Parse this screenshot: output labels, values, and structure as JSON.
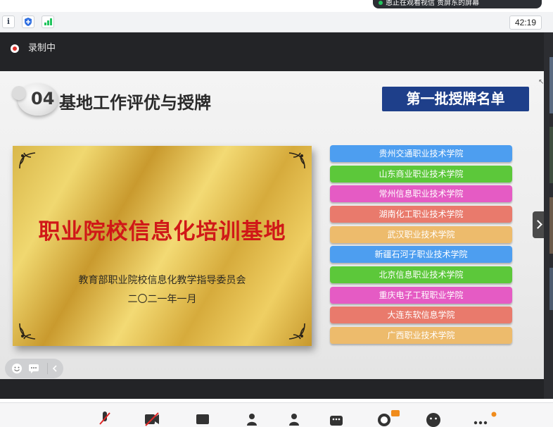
{
  "notification": {
    "text": "恩正在观看视信 贵屏东的屏幕",
    "icon": "green-dot"
  },
  "status_bar": {
    "timer": "42:19",
    "icons": [
      "info-icon",
      "shield-icon",
      "signal-icon"
    ]
  },
  "recording": {
    "label": "录制中",
    "icon": "record-dot"
  },
  "slide": {
    "section_number": "04",
    "section_title": "基地工作评优与授牌",
    "list_title": "第一批授牌名单",
    "plaque": {
      "title": "职业院校信息化培训基地",
      "issuer": "教育部职业院校信息化教学指导委员会",
      "date": "二〇二一年一月"
    },
    "schools": [
      {
        "name": "贵州交通职业技术学院",
        "color": "#4d9ef0"
      },
      {
        "name": "山东商业职业技术学院",
        "color": "#5cc83a"
      },
      {
        "name": "常州信息职业技术学院",
        "color": "#e55bc4"
      },
      {
        "name": "湖南化工职业技术学院",
        "color": "#e97a6c"
      },
      {
        "name": "武汉职业技术学院",
        "color": "#edbb6c"
      },
      {
        "name": "新疆石河子职业技术学院",
        "color": "#4d9ef0"
      },
      {
        "name": "北京信息职业技术学院",
        "color": "#5cc83a"
      },
      {
        "name": "重庆电子工程职业学院",
        "color": "#e55bc4"
      },
      {
        "name": "大连东软信息学院",
        "color": "#e97a6c"
      },
      {
        "name": "广西职业技术学院",
        "color": "#edbb6c"
      }
    ]
  },
  "float_toolbar": {
    "buttons": [
      "emoji-icon",
      "chat-icon",
      "collapse-icon"
    ]
  },
  "bottom_toolbar": {
    "icons": [
      "mic-muted-icon",
      "camera-off-icon",
      "share-icon",
      "participants-icon",
      "invite-icon",
      "apps-icon",
      "record-icon",
      "emoji-reaction-icon",
      "more-icon"
    ]
  },
  "colors": {
    "rec_bar": "#232427",
    "list_title_bg": "#1e3f8a",
    "plaque_text": "#d01818"
  }
}
